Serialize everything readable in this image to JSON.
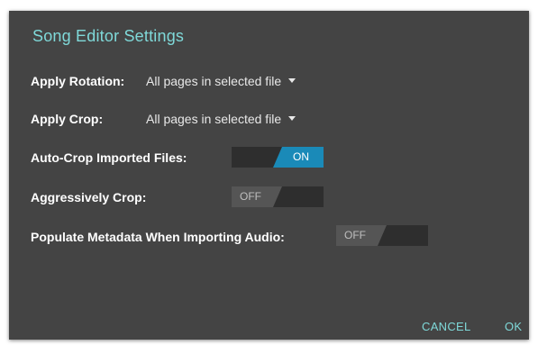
{
  "dialog": {
    "title": "Song Editor Settings",
    "rows": [
      {
        "label": "Apply Rotation:",
        "value": "All pages in selected file"
      },
      {
        "label": "Apply Crop:",
        "value": "All pages in selected file"
      },
      {
        "label": "Auto-Crop Imported Files:",
        "toggle": "ON"
      },
      {
        "label": "Aggressively Crop:",
        "toggle": "OFF"
      },
      {
        "label": "Populate Metadata When Importing Audio:",
        "toggle": "OFF"
      }
    ],
    "buttons": {
      "cancel": "CANCEL",
      "ok": "OK"
    }
  },
  "colors": {
    "background": "#444444",
    "accent": "#7fd9d9",
    "toggle_on": "#1a8ab8"
  }
}
